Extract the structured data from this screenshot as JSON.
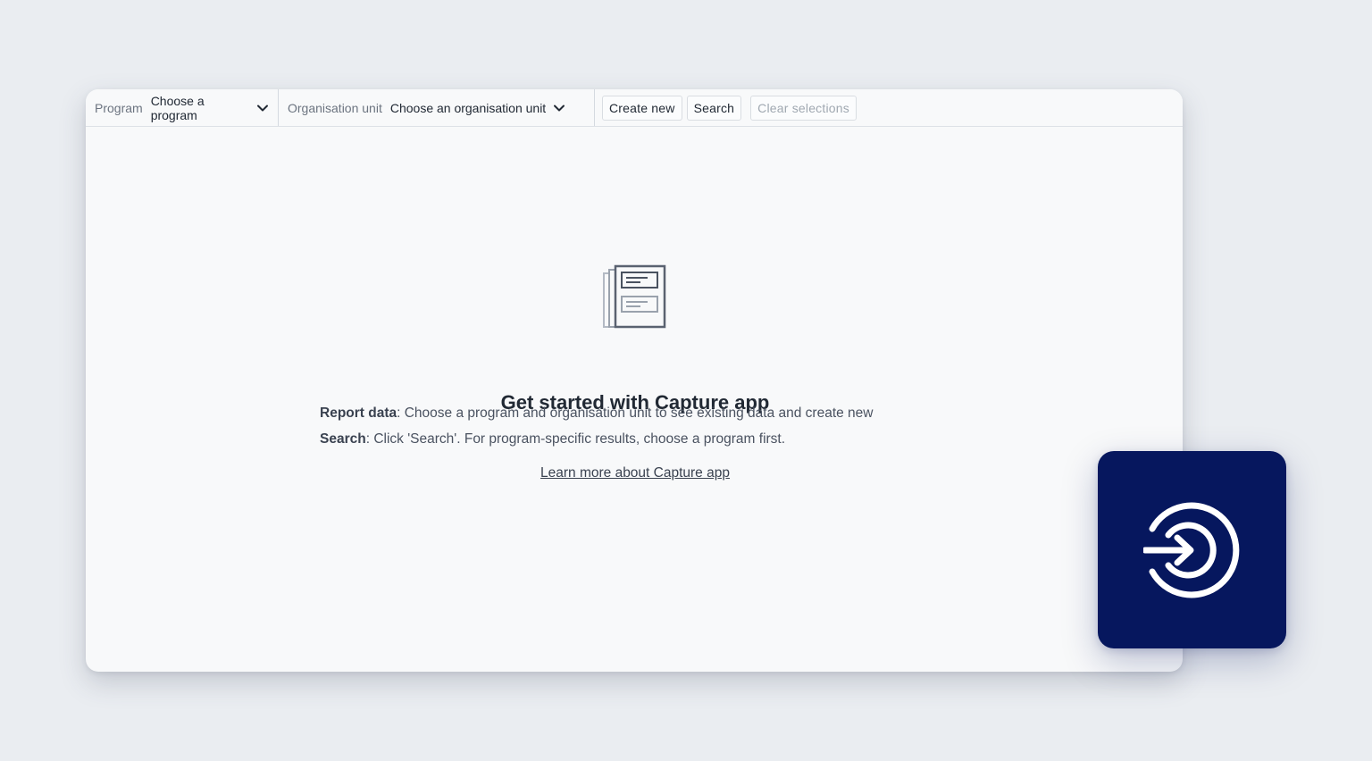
{
  "topbar": {
    "program": {
      "label": "Program",
      "value": "Choose a program"
    },
    "org_unit": {
      "label": "Organisation unit",
      "value": "Choose an organisation unit"
    },
    "buttons": {
      "create_new": "Create new",
      "search": "Search",
      "clear_selections": "Clear selections"
    }
  },
  "main": {
    "heading": "Get started with Capture app",
    "report_data_label": "Report data",
    "report_data_text": ": Choose a program and organisation unit to see existing data and create new",
    "search_label": "Search",
    "search_text": ": Click 'Search'. For program-specific results, choose a program first.",
    "learn_more_link": "Learn more about Capture app"
  },
  "icons": {
    "chevron": "chevron-down-icon",
    "illustration": "document-stack-icon",
    "app_logo": "capture-app-logo-icon"
  },
  "colors": {
    "background": "#eaedf1",
    "app_badge": "#06175e",
    "text_primary": "#212934",
    "text_secondary": "#6c7480"
  }
}
